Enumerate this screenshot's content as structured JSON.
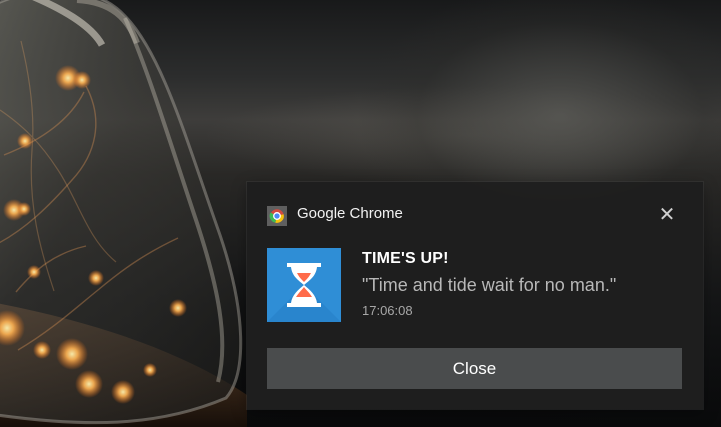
{
  "wallpaper": {
    "jar_lights_color": "#ffb15a",
    "background_tone": "#2f2f2f"
  },
  "notification": {
    "app_name": "Google Chrome",
    "app_icon": "chrome-icon",
    "dismiss_icon": "close-icon",
    "dismiss_glyph": "✕",
    "hero_icon": "hourglass-icon",
    "title": "TIME'S UP!",
    "message": "\"Time and tide wait for no man.\"",
    "timestamp": "17:06:08",
    "button_label": "Close",
    "colors": {
      "panel": "#1f1f1f",
      "button": "#4a4c4d",
      "icon_blue": "#2f8ed6",
      "icon_orange": "#ff6b4a"
    }
  }
}
